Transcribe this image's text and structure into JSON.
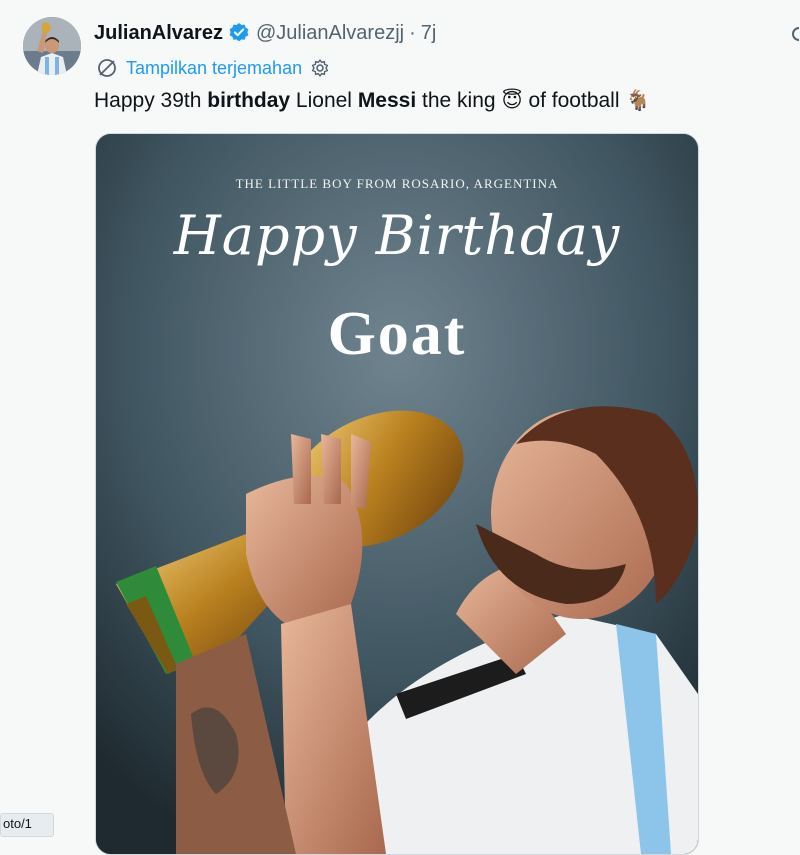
{
  "tweet": {
    "author_name": "JulianAlvarez",
    "handle": "@JulianAlvarezjj",
    "separator": "·",
    "time": "7j",
    "translate_label": "Tampilkan terjemahan",
    "text_parts": {
      "p1": "Happy 39th ",
      "b1": "birthday",
      "p2": " Lionel ",
      "b2": "Messi",
      "p3": " the king",
      "e1": "😇",
      "p4": "of football",
      "e2": "🐐"
    }
  },
  "media": {
    "subtitle": "THE LITTLE BOY FROM ROSARIO, ARGENTINA",
    "headline": "Happy Birthday",
    "goat": "Goat"
  },
  "status_bar": {
    "url_fragment": "oto/1"
  },
  "colors": {
    "link": "#1d9bf0",
    "verified": "#1d9bf0",
    "text": "#0f1419",
    "secondary": "#536471"
  },
  "icons": {
    "verified": "verified-badge-icon",
    "translate": "translate-icon",
    "settings": "gear-icon",
    "more": "more-icon"
  }
}
